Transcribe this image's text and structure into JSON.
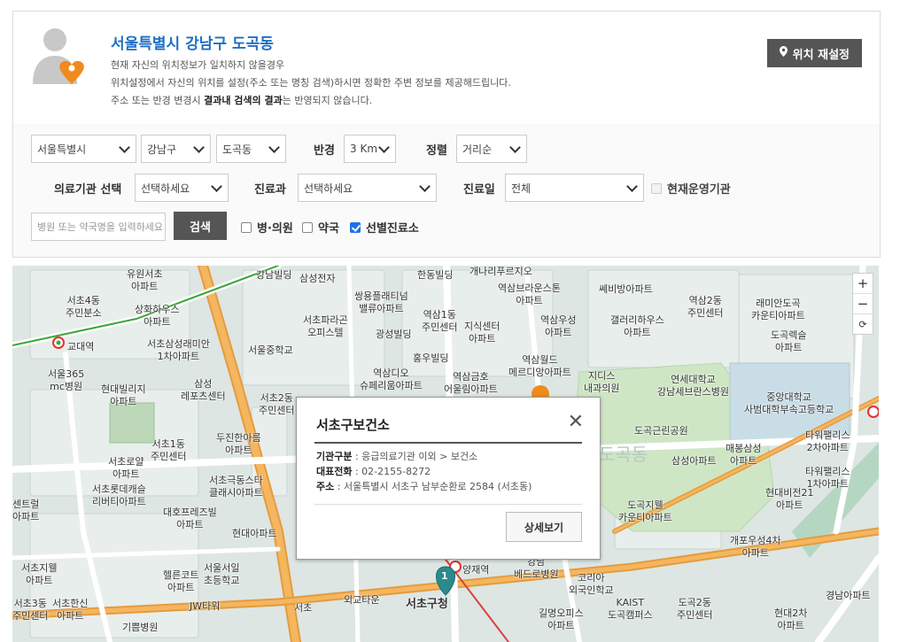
{
  "location": {
    "title": "서울특별시 강남구 도곡동",
    "line1": "현재 자신의 위치정보가 일치하지 않을경우",
    "line2": "위치설정에서 자신의 위치를 설정(주소 또는 명칭 검색)하시면 정확한 주변 정보를 제공해드립니다.",
    "line3a": "주소 또는 반경 변경시 ",
    "line3b": "결과내 검색의 결과",
    "line3c": "는 반영되지 않습니다.",
    "reset_label": "위치 재설정"
  },
  "filters": {
    "city": "서울특별시",
    "district": "강남구",
    "dong": "도곡동",
    "radius_label": "반경",
    "radius": "3 Km",
    "sort_label": "정렬",
    "sort": "거리순",
    "institution_label": "의료기관 선택",
    "institution": "선택하세요",
    "dept_label": "진료과",
    "dept": "선택하세요",
    "day_label": "진료일",
    "day": "전체",
    "open_now_label": "현재운영기관",
    "search_placeholder": "병원 또는 약국명을 입력하세요",
    "search_label": "검색",
    "hospital_label": "병·의원",
    "pharmacy_label": "약국",
    "screening_label": "선별진료소"
  },
  "map": {
    "zoom_in": "+",
    "zoom_out": "−",
    "reset": "⟳",
    "labels": [
      "유원서초",
      "아파트",
      "서초4동",
      "주민분소",
      "교대역",
      "서울365",
      "mc병원",
      "현대빌리지",
      "아파트",
      "삼성",
      "레포츠센터",
      "강남빌딩",
      "삼성전자",
      "쌍용플래티넘",
      "밸류아파트",
      "서초파라곤",
      "오피스텔",
      "광성빌딩",
      "서울중학교",
      "역삼1동",
      "주민센터",
      "지식센터",
      "역삼센트럴",
      "아파트",
      "홍우빌딩",
      "역삼디오",
      "슈페리움아파트",
      "역삼금호",
      "어울림아파트",
      "역삼월드",
      "메르디앙아파트",
      "역삼브라운스톤",
      "아파트",
      "쎄비방아파트",
      "역삼우성",
      "아파트",
      "갤러리하우스",
      "아파트",
      "역삼2동",
      "주민센터",
      "래미안도곡",
      "카운티아파트",
      "도곡렉슬",
      "아파트",
      "지디스",
      "내과의원",
      "연세대학교",
      "강남세브란스병원",
      "중앙대학교",
      "사범대학부속고등학교",
      "도곡근린공원",
      "도곡동",
      "삼성아파트",
      "매봉삼성",
      "아파트",
      "타워팰리스",
      "2차아파트",
      "타워팰리스",
      "1차아파트",
      "현대비전21",
      "아파트",
      "도곡지웰",
      "카운티아파트",
      "개포우성4차",
      "아파트",
      "서초1동",
      "주민센터",
      "서초로얄",
      "아파트",
      "서초롯데캐슬",
      "리버티아파트",
      "두진한아름",
      "아파트",
      "서초극동스타",
      "클래시아파트",
      "대호프레즈빌",
      "아파트",
      "현대아파트",
      "서울서일",
      "초등학교",
      "서초지웰",
      "아파트",
      "헬른코트",
      "아파트",
      "서초3동",
      "주민센터",
      "서초한신",
      "아파트",
      "JW타워",
      "기쁨병원",
      "외교타운",
      "서초구청",
      "양재역",
      "강남",
      "베드로병원",
      "코리아",
      "외국인학교",
      "KAIST",
      "도곡캠퍼스",
      "도곡2동",
      "주민센터",
      "길명오피스",
      "아파트",
      "현대2차",
      "아파트",
      "경남아파트",
      "서초",
      "센트럴",
      "아파트",
      "한동빌딩",
      "개나리푸르지오",
      "아파트",
      "서초2동",
      "주민센터",
      "상화하우스",
      "아파트",
      "서초삼성래미안",
      "1차아파트"
    ]
  },
  "popup": {
    "title": "서초구보건소",
    "close": "✕",
    "type_label": "기관구분",
    "type_value": " : 응급의료기관 이외 > 보건소",
    "phone_label": "대표전화",
    "phone_value": " : 02-2155-8272",
    "addr_label": "주소",
    "addr_value": " : 서울특별시 서초구 남부순환로 2584 (서초동)",
    "detail_label": "상세보기"
  },
  "marker": {
    "number": "1"
  },
  "colors": {
    "title_blue": "#1f6fc5",
    "button_dark": "#555555",
    "marker_teal": "#2a8a8c",
    "marker_orange": "#f08a1c"
  }
}
